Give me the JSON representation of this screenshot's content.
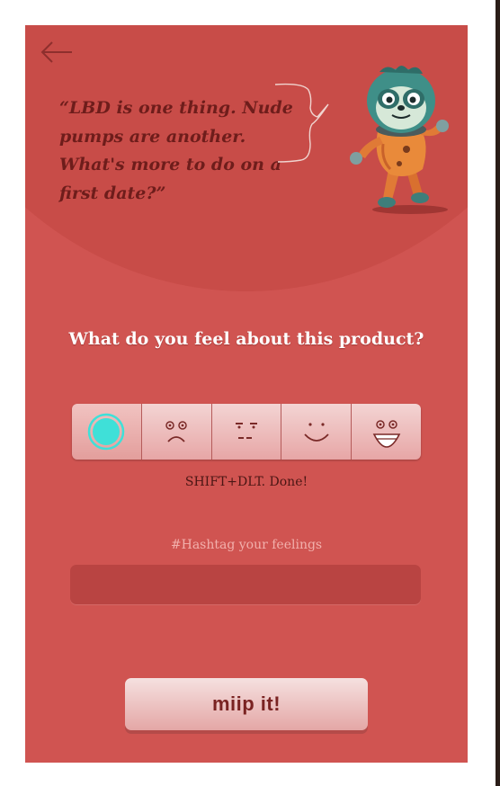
{
  "nav": {
    "back_icon": "arrow-left-icon"
  },
  "hero": {
    "quote": "“LBD is one thing. Nude pumps are another. What's more to do on a first date?”",
    "mascot": "astronaut-sloth-illustration"
  },
  "question": "What do you feel about this product?",
  "rating": {
    "options": [
      {
        "icon": "selected-circle-icon",
        "selected": true
      },
      {
        "icon": "sad-face-icon",
        "selected": false
      },
      {
        "icon": "annoyed-face-icon",
        "selected": false
      },
      {
        "icon": "smile-face-icon",
        "selected": false
      },
      {
        "icon": "grin-face-icon",
        "selected": false
      }
    ],
    "caption": "SHIFT+DLT. Done!"
  },
  "hashtag": {
    "label": "#Hashtag your feelings",
    "value": ""
  },
  "submit_label": "miip it!",
  "colors": {
    "background": "#d05451",
    "hero": "#c84c48",
    "quote_text": "#6e1d1b",
    "accent": "#3fe0d8",
    "input": "#b94442"
  }
}
